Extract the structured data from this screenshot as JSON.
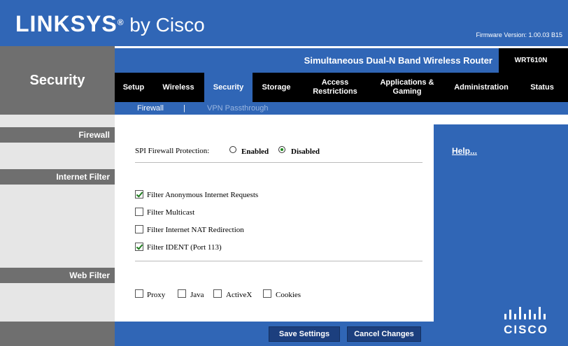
{
  "header": {
    "brand": "LINKSYS",
    "registered": "®",
    "by_cisco": " by Cisco",
    "firmware": "Firmware Version: 1.00.03 B15"
  },
  "product": {
    "name": "Simultaneous Dual-N Band Wireless Router",
    "model": "WRT610N"
  },
  "page_title": "Security",
  "nav": {
    "tabs": [
      {
        "label": "Setup"
      },
      {
        "label": "Wireless"
      },
      {
        "label": "Security"
      },
      {
        "label": "Storage"
      },
      {
        "label": "Access Restrictions"
      },
      {
        "label": "Applications & Gaming"
      },
      {
        "label": "Administration"
      },
      {
        "label": "Status"
      }
    ],
    "active": "Security"
  },
  "subnav": {
    "items": [
      {
        "label": "Firewall"
      },
      {
        "label": "|"
      },
      {
        "label": "VPN Passthrough"
      }
    ]
  },
  "sections": {
    "firewall": "Firewall",
    "internet_filter": "Internet Filter",
    "web_filter": "Web Filter"
  },
  "firewall": {
    "spi_label": "SPI Firewall Protection:",
    "enabled_label": "Enabled",
    "disabled_label": "Disabled",
    "selected": "Disabled"
  },
  "internet_filter": {
    "items": [
      {
        "label": "Filter Anonymous Internet Requests",
        "checked": true
      },
      {
        "label": "Filter Multicast",
        "checked": false
      },
      {
        "label": "Filter Internet NAT Redirection",
        "checked": false
      },
      {
        "label": "Filter IDENT (Port 113)",
        "checked": true
      }
    ]
  },
  "web_filter": {
    "items": [
      {
        "label": "Proxy",
        "checked": false
      },
      {
        "label": "Java",
        "checked": false
      },
      {
        "label": "ActiveX",
        "checked": false
      },
      {
        "label": "Cookies",
        "checked": false
      }
    ]
  },
  "help": {
    "label": "Help..."
  },
  "buttons": {
    "save": "Save Settings",
    "cancel": "Cancel Changes"
  },
  "colors": {
    "brand_blue": "#3066b6",
    "nav_black": "#000000",
    "section_gray": "#6f6f6f"
  }
}
